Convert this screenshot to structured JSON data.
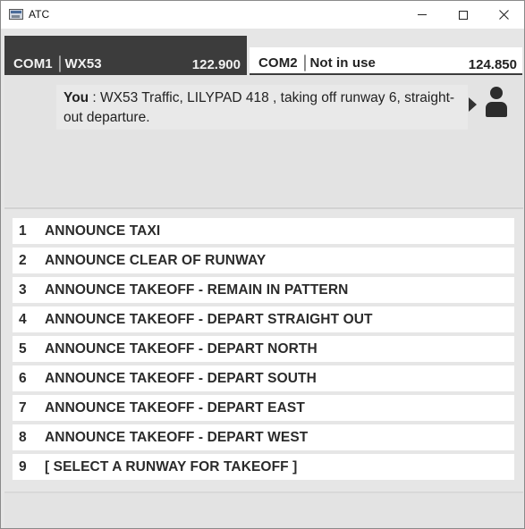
{
  "window": {
    "title": "ATC"
  },
  "com1": {
    "label": "COM1 │WX53",
    "frequency": "122.900"
  },
  "com2": {
    "label": "COM2 │Not in use",
    "frequency": "124.850"
  },
  "message": {
    "speaker": "You",
    "separator": " : ",
    "text": "WX53 Traffic, LILYPAD 418 , taking off runway 6, straight-out departure."
  },
  "options": [
    {
      "num": "1",
      "label": "ANNOUNCE TAXI"
    },
    {
      "num": "2",
      "label": "ANNOUNCE CLEAR OF RUNWAY"
    },
    {
      "num": "3",
      "label": "ANNOUNCE TAKEOFF - REMAIN IN PATTERN"
    },
    {
      "num": "4",
      "label": "ANNOUNCE TAKEOFF - DEPART STRAIGHT OUT"
    },
    {
      "num": "5",
      "label": "ANNOUNCE TAKEOFF - DEPART NORTH"
    },
    {
      "num": "6",
      "label": "ANNOUNCE TAKEOFF - DEPART SOUTH"
    },
    {
      "num": "7",
      "label": "ANNOUNCE TAKEOFF - DEPART EAST"
    },
    {
      "num": "8",
      "label": "ANNOUNCE TAKEOFF - DEPART WEST"
    },
    {
      "num": "9",
      "label": "[ SELECT A RUNWAY FOR TAKEOFF ]"
    }
  ],
  "icons": {
    "app": "app-window-icon",
    "minimize": "minimize-icon",
    "maximize": "maximize-icon",
    "close": "close-icon",
    "play": "play-icon",
    "user": "user-icon"
  },
  "colors": {
    "com1_active_bg": "#3c3c3c",
    "com2_bg": "#ffffff",
    "panel_bg": "#e6e6e6"
  }
}
